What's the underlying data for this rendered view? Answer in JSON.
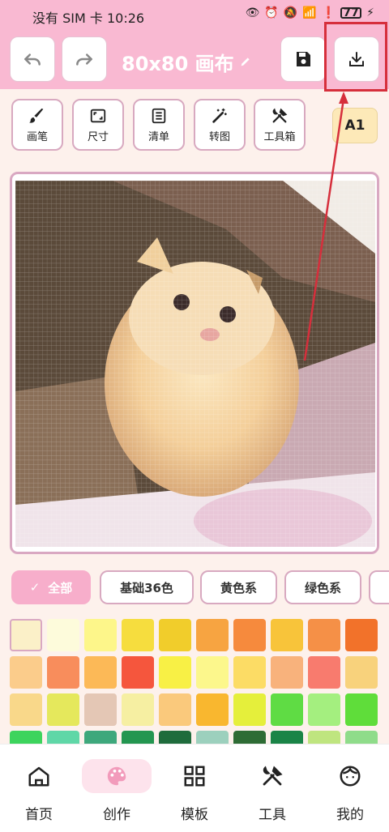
{
  "status_bar": {
    "carrier": "没有 SIM 卡",
    "time": "10:26",
    "battery": "77"
  },
  "header": {
    "title": "80x80 画布",
    "undo_icon": "undo-icon",
    "redo_icon": "redo-icon",
    "save_icon": "save-icon",
    "export_icon": "download-icon"
  },
  "tools": [
    {
      "label": "画笔",
      "icon": "brush-icon"
    },
    {
      "label": "尺寸",
      "icon": "resize-icon"
    },
    {
      "label": "清单",
      "icon": "list-icon"
    },
    {
      "label": "转图",
      "icon": "magic-wand-icon"
    },
    {
      "label": "工具箱",
      "icon": "tools-icon"
    }
  ],
  "layer_badge": "A1",
  "filters": [
    {
      "label": "全部",
      "active": true
    },
    {
      "label": "基础36色",
      "active": false
    },
    {
      "label": "黄色系",
      "active": false
    },
    {
      "label": "绿色系",
      "active": false
    }
  ],
  "palette": [
    "#fbf0c8",
    "#fdfbdb",
    "#fdf68a",
    "#f6dd3e",
    "#f1cd2b",
    "#f7a441",
    "#f68a3d",
    "#f8c43a",
    "#f59047",
    "#f2722a",
    "#fbcc8b",
    "#f88d5c",
    "#fcb957",
    "#f5563d",
    "#f8f045",
    "#fcf78c",
    "#fcdc65",
    "#f8b27c",
    "#f87b6e",
    "#f8d27c",
    "#f9d88a",
    "#e5e85c",
    "#e4c7b5",
    "#f6efa2",
    "#fac97c",
    "#f9b72f",
    "#e5ef3b",
    "#5fdc44",
    "#a4ef7f",
    "#5fdd3a",
    "#3dd45d",
    "#5fd7a7",
    "#3ea87c",
    "#239650",
    "#1f6c3c",
    "#9cd0bd",
    "#2e6c35",
    "#1a8447",
    "#bfe57f",
    "#8fdc8a"
  ],
  "bottom_nav": [
    {
      "label": "首页",
      "icon": "home-icon",
      "active": false
    },
    {
      "label": "创作",
      "icon": "palette-icon",
      "active": true
    },
    {
      "label": "模板",
      "icon": "template-grid-icon",
      "active": false
    },
    {
      "label": "工具",
      "icon": "tools-icon",
      "active": false
    },
    {
      "label": "我的",
      "icon": "profile-face-icon",
      "active": false
    }
  ]
}
